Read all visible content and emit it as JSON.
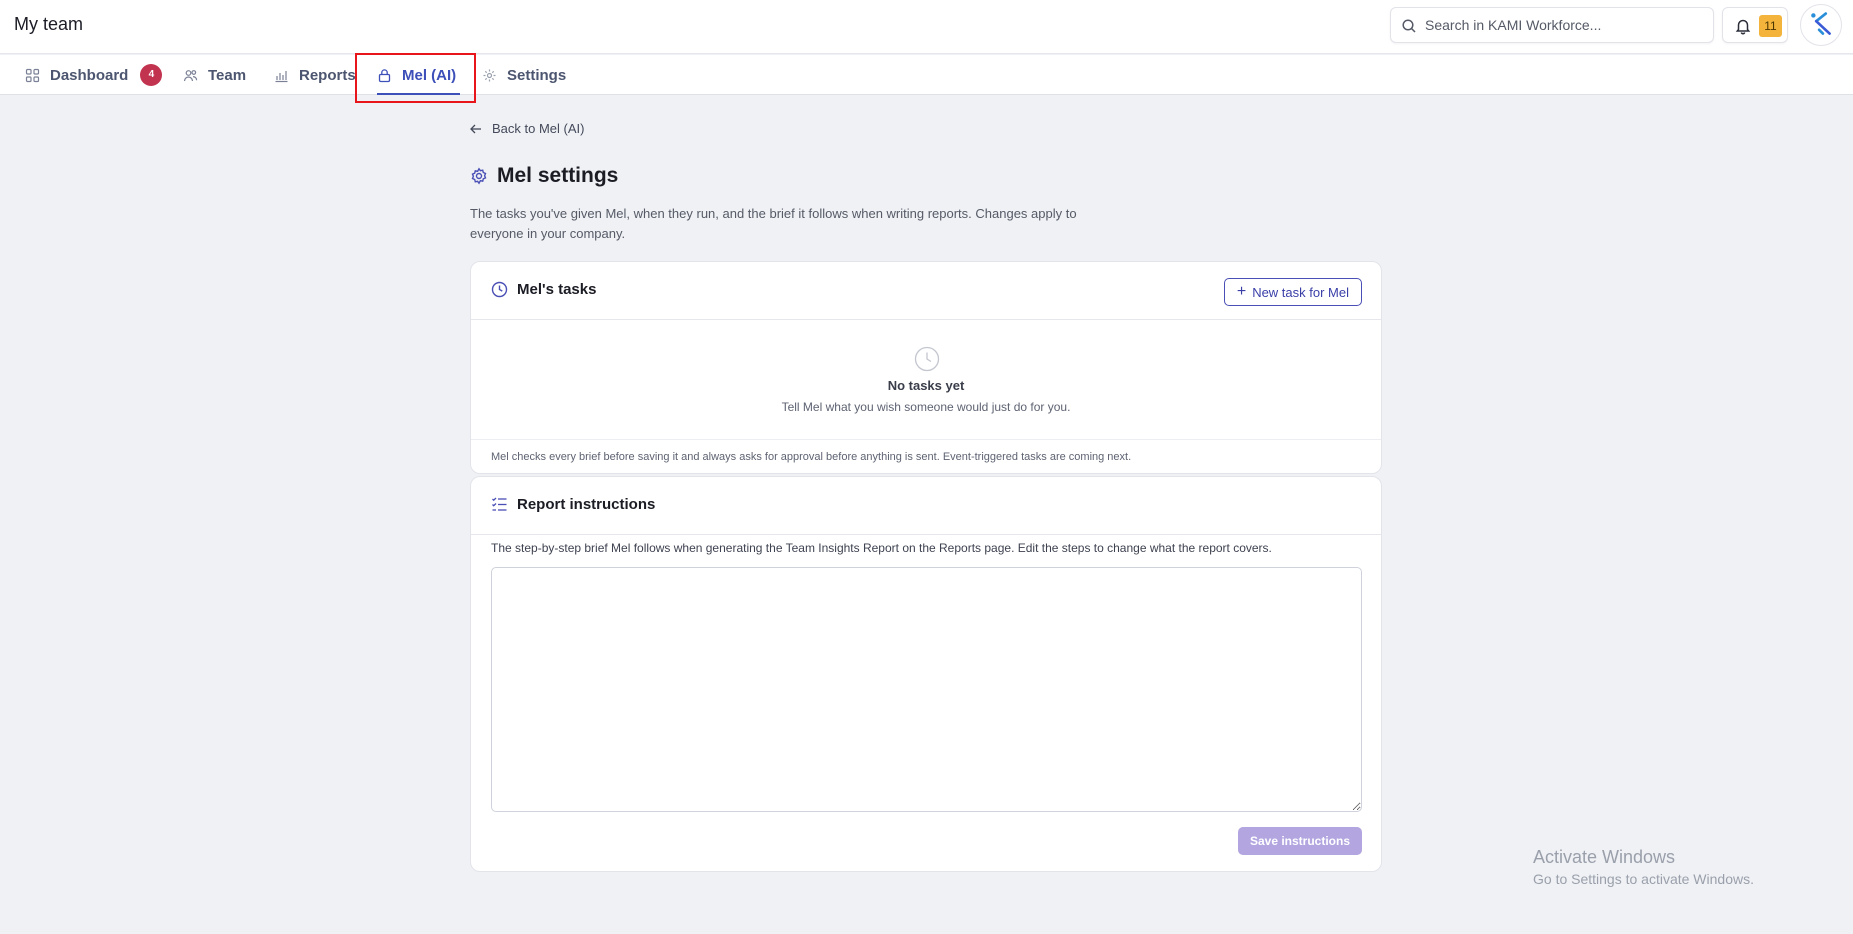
{
  "app": {
    "title": "My team"
  },
  "header": {
    "search_placeholder": "Search in KAMI Workforce...",
    "notification_count": "11"
  },
  "nav": {
    "dashboard_label": "Dashboard",
    "dashboard_badge": "4",
    "team_label": "Team",
    "reports_label": "Reports",
    "mel_label": "Mel (AI)",
    "settings_label": "Settings",
    "active_tab": "Mel (AI)"
  },
  "page": {
    "back_label": "Back to Mel (AI)",
    "title": "Mel settings",
    "description": "The tasks you've given Mel, when they run, and the brief it follows when writing reports. Changes apply to everyone in your company."
  },
  "tasks_card": {
    "title": "Mel's tasks",
    "new_button": "New task for Mel",
    "empty_title": "No tasks yet",
    "empty_subtitle": "Tell Mel what you wish someone would just do for you.",
    "footer_note": "Mel checks every brief before saving it and always asks for approval before anything is sent. Event-triggered tasks are coming next."
  },
  "instructions_card": {
    "title": "Report instructions",
    "description": "The step-by-step brief Mel follows when generating the Team Insights Report on the Reports page. Edit the steps to change what the report covers.",
    "textarea_value": "",
    "save_button": "Save instructions",
    "save_enabled": false
  },
  "watermark": {
    "line1": "Activate Windows",
    "line2": "Go to Settings to activate Windows."
  },
  "colors": {
    "accent": "#3d4fb8",
    "badge": "#c2334f",
    "notification": "#f4b43b",
    "save_disabled": "#b2a5e0",
    "highlight": "#e8161a"
  }
}
